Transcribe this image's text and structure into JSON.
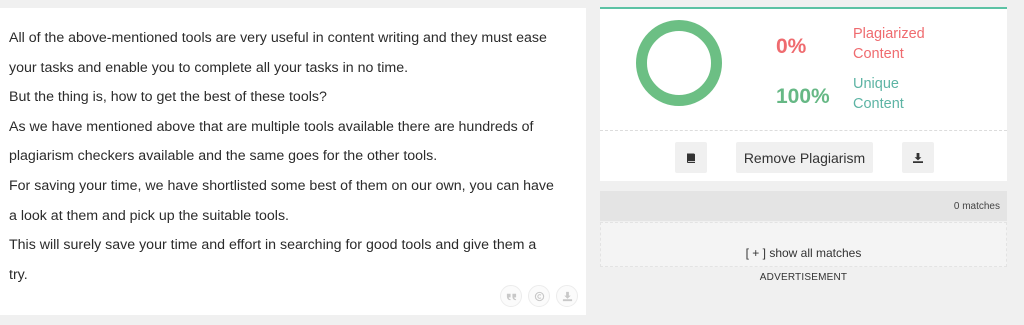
{
  "article": {
    "lines": [
      "All of the above-mentioned tools are very useful in content writing and they must ease",
      "your tasks and enable you to complete all your tasks in no time.",
      "But the thing is, how to get the best of these tools?",
      "As we have mentioned above that are multiple tools available there are hundreds of",
      "plagiarism checkers available and the same goes for the other tools.",
      "For saving your time, we have shortlisted some best of them on our own, you can have",
      "a look at them and pick up the suitable tools.",
      "This will surely save your time and effort in searching for good tools and give them a",
      "try."
    ],
    "action_icons": [
      "quote-icon",
      "copyright-icon",
      "download-icon"
    ]
  },
  "result": {
    "plagiarized_percent": "0%",
    "plagiarized_label_1": "Plagiarized",
    "plagiarized_label_2": "Content",
    "unique_percent": "100%",
    "unique_label_1": "Unique",
    "unique_label_2": "Content",
    "unique_fraction": 1.0,
    "donut_color": "#6cbf84",
    "plagiarized_color": "#ef6b6f",
    "unique_color": "#66b885",
    "remove_button": "Remove Plagiarism",
    "left_icon": "book-icon",
    "right_icon": "download-icon"
  },
  "matches": {
    "count_text": "0 matches",
    "show_all": "[ + ] show all matches"
  },
  "ad_label": "ADVERTISEMENT"
}
